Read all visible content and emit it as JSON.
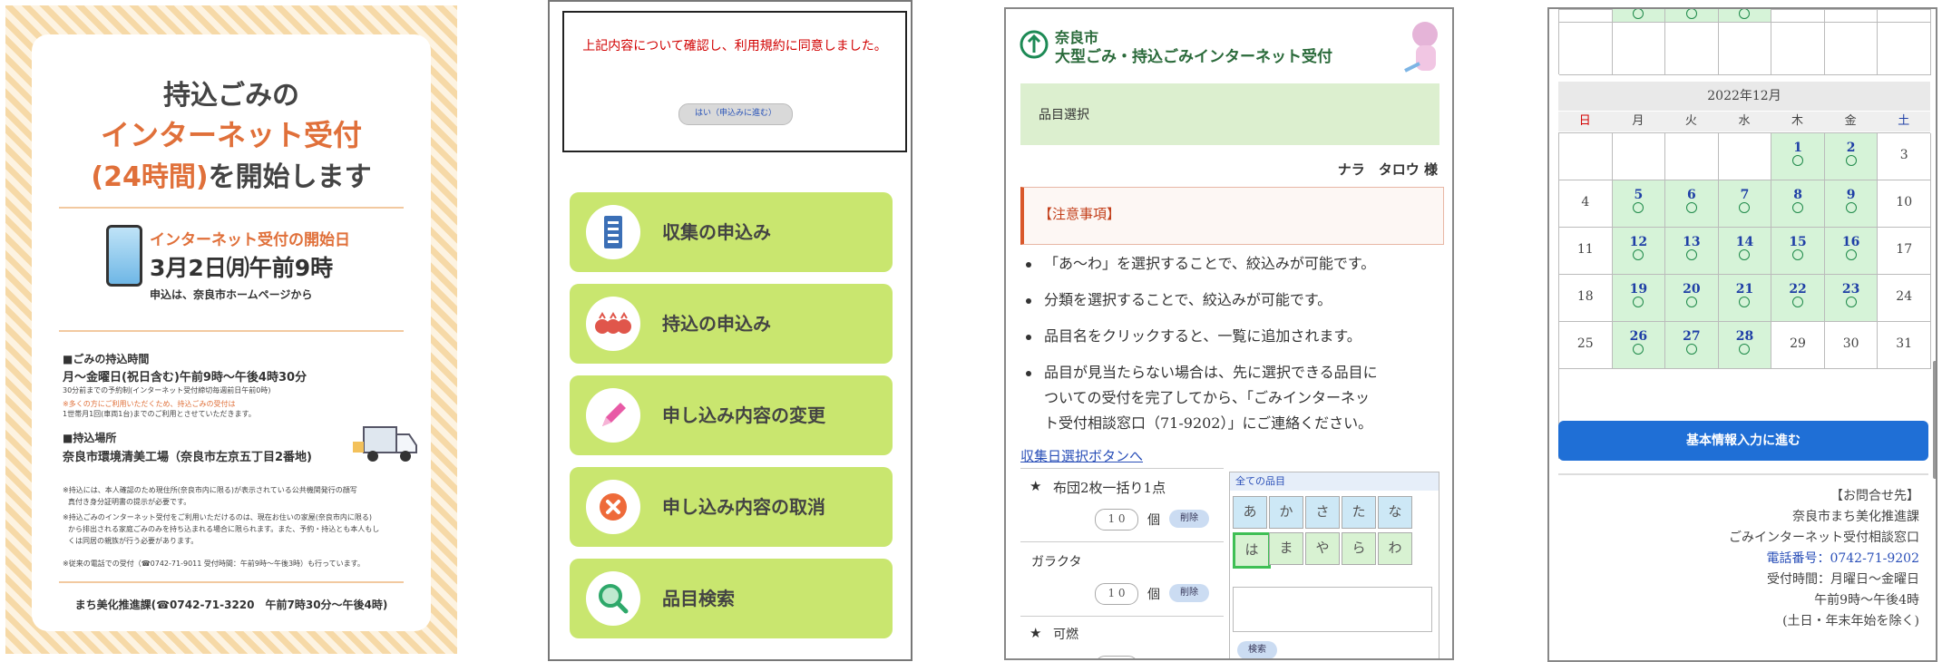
{
  "poster": {
    "title_line1": "持込ごみの",
    "title_line2": "インターネット受付",
    "title_line3a": "(24時間)",
    "title_line3b": "を開始します",
    "start_heading": "インターネット受付の開始日",
    "start_date": "3月2日㈪午前9時",
    "apply_from": "申込は、奈良市ホームページから",
    "hours_heading": "■ごみの持込時間",
    "hours_text": "月～金曜日(祝日含む)午前9時～午後4時30分",
    "hours_note1": "30分前までの予約制(インターネット受付締切毎週前日午前0時)",
    "hours_note2": "※多くの方にご利用いただくため、持込ごみの受付は",
    "hours_note3": "1世帯月1回(車両1台)までのご利用とさせていただきます。",
    "place_heading": "■持込場所",
    "place_text": "奈良市環境清美工場（奈良市左京五丁目2番地)",
    "fine1a": "※持込には、本人確認のため現住所(奈良市内に限る)が表示されている公共機関発行の顔写",
    "fine1b": "真付き身分証明書の提示が必要です。",
    "fine2a": "※持込ごみのインターネット受付をご利用いただけるのは、現在お住いの家屋(奈良市内に限る)",
    "fine2b": "から排出される家庭ごみのみを持ち込まれる場合に限られます。また、予約・持込とも本人もし",
    "fine2c": "くは同居の親族が行う必要があります。",
    "fine3": "※従来の電話での受付（☎0742-71-9011 受付時間：午前9時～午後3時）も行っています。",
    "footer": "まち美化推進課(☎0742-71-3220　午前7時30分～午後4時)"
  },
  "menu": {
    "notice_text": "上記内容について確認し、利用規約に同意しました。",
    "agree_button": "はい（申込みに進む）",
    "items": [
      {
        "label": "収集の申込み",
        "icon": "building-icon"
      },
      {
        "label": "持込の申込み",
        "icon": "garbage-bags-icon"
      },
      {
        "label": "申し込み内容の変更",
        "icon": "pencil-icon"
      },
      {
        "label": "申し込み内容の取消",
        "icon": "cancel-icon"
      },
      {
        "label": "品目検索",
        "icon": "search-icon"
      }
    ]
  },
  "item_select": {
    "header_line1": "奈良市",
    "header_line2": "大型ごみ・持込ごみインターネット受付",
    "section": "品目選択",
    "user_name": "ナラ　タロウ 様",
    "notice_heading": "【注意事項】",
    "bullets": [
      "「あ～わ」を選択することで、絞込みが可能です。",
      "分類を選択することで、絞込みが可能です。",
      "品目名をクリックすると、一覧に追加されます。",
      "品目が見当たらない場合は、先に選択できる品目に",
      "ついての受付を完了してから、「ごみインターネッ",
      "ト受付相談窓口（71-9202）」にご連絡ください。"
    ],
    "link": "収集日選択ボタンへ",
    "rows": [
      {
        "star": "★",
        "name": "布団2枚一括り1点",
        "qty": "1 0",
        "unit": "個",
        "del": "削除"
      },
      {
        "star": "",
        "name": "ガラクタ",
        "qty": "1 0",
        "unit": "個",
        "del": "削除"
      },
      {
        "star": "★",
        "name": "可燃",
        "qty": "",
        "unit": "",
        "del": ""
      }
    ],
    "all_items": "全ての品目",
    "kana_row1": [
      "あ",
      "か",
      "さ",
      "た",
      "な"
    ],
    "kana_row2": [
      "は",
      "ま",
      "や",
      "ら",
      "わ"
    ],
    "search_btn": "検索"
  },
  "calendar": {
    "month": "2022年12月",
    "dow": [
      "日",
      "月",
      "火",
      "水",
      "木",
      "金",
      "土"
    ],
    "weeks": [
      [
        [
          "",
          0
        ],
        [
          "",
          0
        ],
        [
          "",
          0
        ],
        [
          "",
          0
        ],
        [
          "1",
          1
        ],
        [
          "2",
          1
        ],
        [
          "3",
          0
        ]
      ],
      [
        [
          "4",
          0
        ],
        [
          "5",
          1
        ],
        [
          "6",
          1
        ],
        [
          "7",
          1
        ],
        [
          "8",
          1
        ],
        [
          "9",
          1
        ],
        [
          "10",
          0
        ]
      ],
      [
        [
          "11",
          0
        ],
        [
          "12",
          1
        ],
        [
          "13",
          1
        ],
        [
          "14",
          1
        ],
        [
          "15",
          1
        ],
        [
          "16",
          1
        ],
        [
          "17",
          0
        ]
      ],
      [
        [
          "18",
          0
        ],
        [
          "19",
          1
        ],
        [
          "20",
          1
        ],
        [
          "21",
          1
        ],
        [
          "22",
          1
        ],
        [
          "23",
          1
        ],
        [
          "24",
          0
        ]
      ],
      [
        [
          "25",
          0
        ],
        [
          "26",
          1
        ],
        [
          "27",
          1
        ],
        [
          "28",
          1
        ],
        [
          "29",
          0
        ],
        [
          "30",
          0
        ],
        [
          "31",
          0
        ]
      ],
      [
        [
          "",
          0
        ],
        [
          "",
          0
        ],
        [
          "",
          0
        ],
        [
          "",
          0
        ],
        [
          "",
          0
        ],
        [
          "",
          0
        ],
        [
          "",
          0
        ]
      ]
    ],
    "next_button": "基本情報入力に進む",
    "info": [
      "【お問合せ先】",
      "奈良市まち美化推進課",
      "ごみインターネット受付相談窓口",
      "電話番号：0742-71-9202",
      "受付時間：月曜日～金曜日",
      "午前9時～午後4時",
      "(土日・年末年始を除く)"
    ],
    "colors": {
      "available": "#d6f3d8",
      "button": "#1f6fd6",
      "sunday": "#d40000",
      "saturday": "#1f3fa6"
    }
  }
}
